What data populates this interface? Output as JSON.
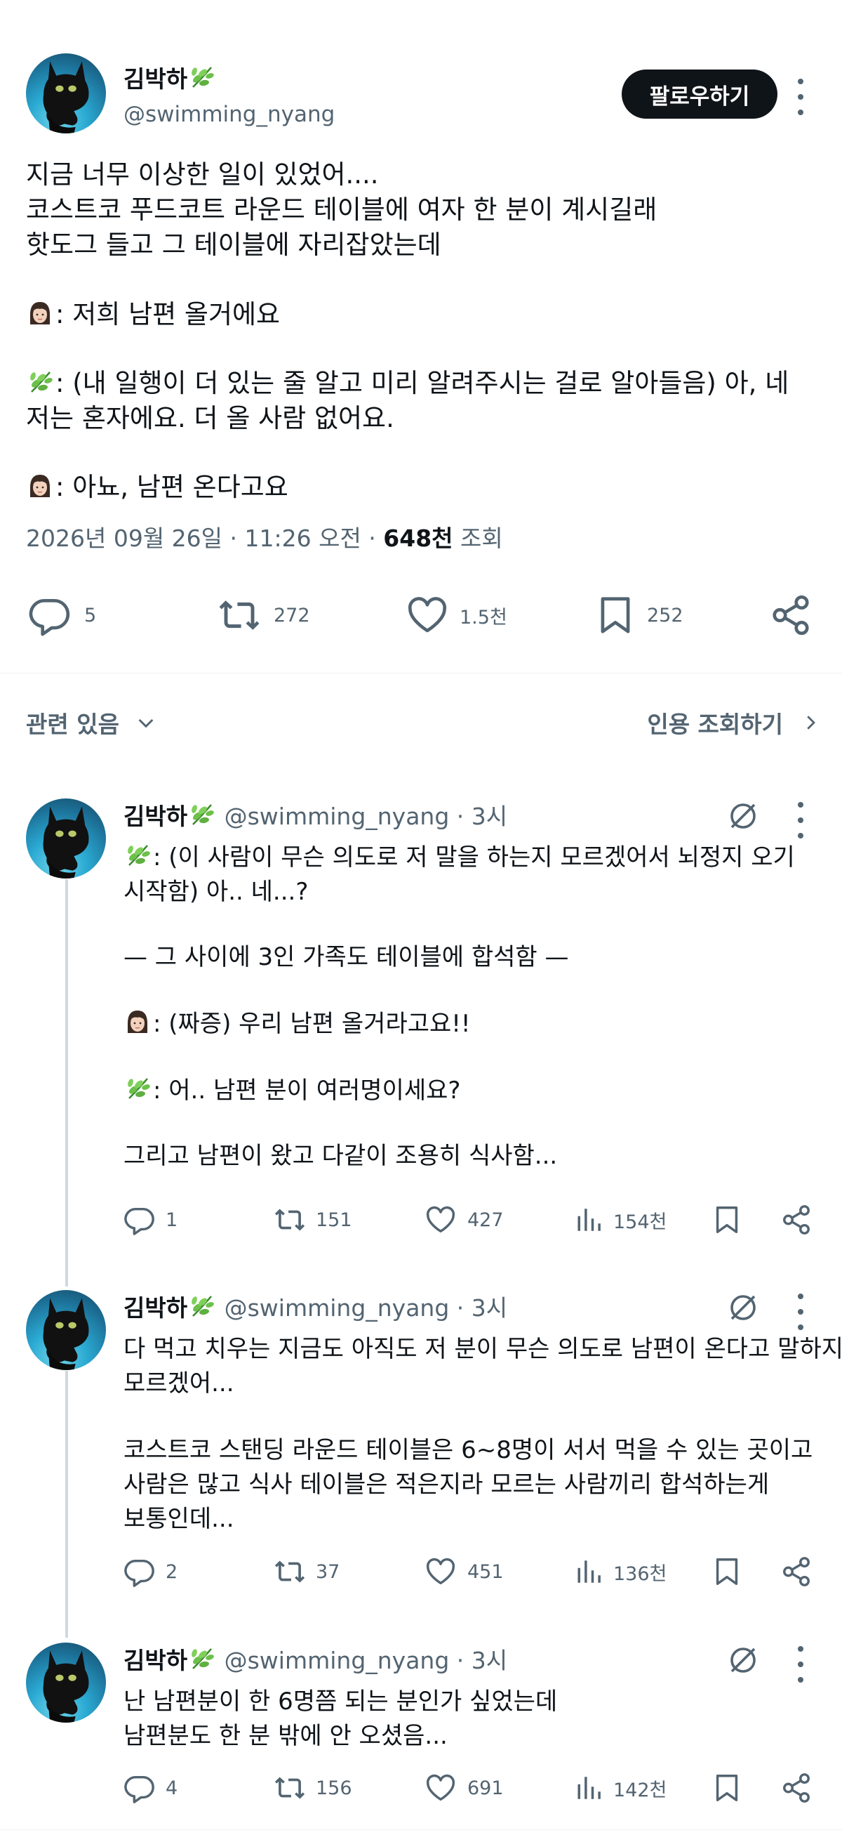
{
  "post": {
    "author_name": "김박하",
    "handle": "@swimming_nyang",
    "follow_label": "팔로우하기",
    "lines": [
      "지금 너무 이상한 일이 있었어....",
      "코스트코 푸드코트 라운드 테이블에 여자 한 분이 계시길래",
      "핫도그 들고 그 테이블에 자리잡았는데",
      ": 저희 남편 올거에요",
      ": (내 일행이 더 있는 줄 알고 미리 알려주시는 걸로 알아들음) 아, 네",
      "저는 혼자에요. 더 올 사람 없어요.",
      ": 아뇨, 남편 온다고요"
    ],
    "meta_date": "2026년 09월 26일 · 11:26 오전 ·",
    "meta_views": "648천",
    "meta_views_label": "조회",
    "stats": {
      "replies": "5",
      "reposts": "272",
      "likes": "1.5천",
      "bookmarks": "252"
    }
  },
  "related_label": "관련 있음",
  "quote_label": "인용 조회하기",
  "icons": {
    "reply": "reply-icon",
    "repost": "repost-icon",
    "like": "heart-icon",
    "bookmark": "bookmark-icon",
    "share": "share-icon",
    "views": "views-icon",
    "grok": "grok-icon",
    "more": "more-icon",
    "emoji_woman": "woman-emoji-icon",
    "emoji_herb": "herb-emoji-icon"
  },
  "replies": [
    {
      "author_name": "김박하",
      "handle": "@swimming_nyang",
      "time": "· 3시",
      "lines": [
        ": (이 사람이 무슨 의도로 저 말을 하는지 모르겠어서 뇌정지 오기",
        "시작함) 아.. 네...?",
        "— 그 사이에 3인 가족도 테이블에 합석함 —",
        ": (짜증) 우리 남편 올거라고요!!",
        ": 어.. 남편 분이 여러명이세요?",
        "그리고 남편이 왔고 다같이 조용히 식사함..."
      ],
      "stats": {
        "replies": "1",
        "reposts": "151",
        "likes": "427",
        "views": "154천"
      }
    },
    {
      "author_name": "김박하",
      "handle": "@swimming_nyang",
      "time": "· 3시",
      "lines": [
        "다 먹고 치우는 지금도 아직도 저 분이 무슨 의도로 남편이 온다고 말하지",
        "모르겠어...",
        "코스트코 스탠딩 라운드 테이블은 6~8명이 서서 먹을 수 있는 곳이고",
        "사람은 많고 식사 테이블은 적은지라 모르는 사람끼리 합석하는게",
        "보통인데..."
      ],
      "stats": {
        "replies": "2",
        "reposts": "37",
        "likes": "451",
        "views": "136천"
      }
    },
    {
      "author_name": "김박하",
      "handle": "@swimming_nyang",
      "time": "· 3시",
      "lines": [
        "난 남편분이 한 6명쯤 되는 분인가 싶었는데",
        "남편분도 한 분 밖에 안 오셨음..."
      ],
      "stats": {
        "replies": "4",
        "reposts": "156",
        "likes": "691",
        "views": "142천"
      }
    }
  ]
}
